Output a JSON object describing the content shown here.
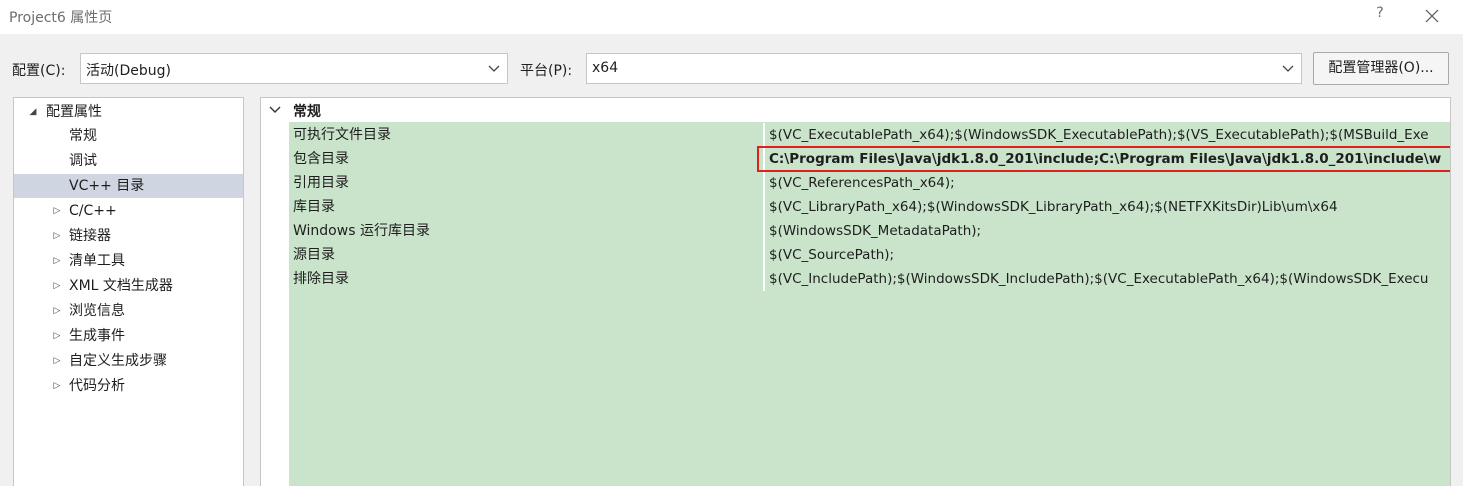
{
  "window": {
    "title": "Project6 属性页",
    "help_label": "?"
  },
  "toolbar": {
    "config_label": "配置(C):",
    "config_value": "活动(Debug)",
    "platform_label": "平台(P):",
    "platform_value": "x64",
    "config_manager_label": "配置管理器(O)..."
  },
  "tree": {
    "root": "配置属性",
    "children": [
      "常规",
      "调试",
      "VC++ 目录"
    ],
    "selected": "VC++ 目录",
    "collapsed_groups": [
      "C/C++",
      "链接器",
      "清单工具",
      "XML 文档生成器",
      "浏览信息",
      "生成事件",
      "自定义生成步骤",
      "代码分析"
    ]
  },
  "grid": {
    "category": "常规",
    "properties": [
      {
        "name": "可执行文件目录",
        "value": "$(VC_ExecutablePath_x64);$(WindowsSDK_ExecutablePath);$(VS_ExecutablePath);$(MSBuild_Exe"
      },
      {
        "name": "包含目录",
        "value": "C:\\Program Files\\Java\\jdk1.8.0_201\\include;C:\\Program Files\\Java\\jdk1.8.0_201\\include\\w"
      },
      {
        "name": "引用目录",
        "value": "$(VC_ReferencesPath_x64);"
      },
      {
        "name": "库目录",
        "value": "$(VC_LibraryPath_x64);$(WindowsSDK_LibraryPath_x64);$(NETFXKitsDir)Lib\\um\\x64"
      },
      {
        "name": "Windows 运行库目录",
        "value": "$(WindowsSDK_MetadataPath);"
      },
      {
        "name": "源目录",
        "value": "$(VC_SourcePath);"
      },
      {
        "name": "排除目录",
        "value": "$(VC_IncludePath);$(WindowsSDK_IncludePath);$(VC_ExecutablePath_x64);$(WindowsSDK_Execu"
      }
    ]
  },
  "colors": {
    "grid_background": "#c9e4cb",
    "selection": "#cfd5e1",
    "highlight_border": "#e0201a"
  }
}
